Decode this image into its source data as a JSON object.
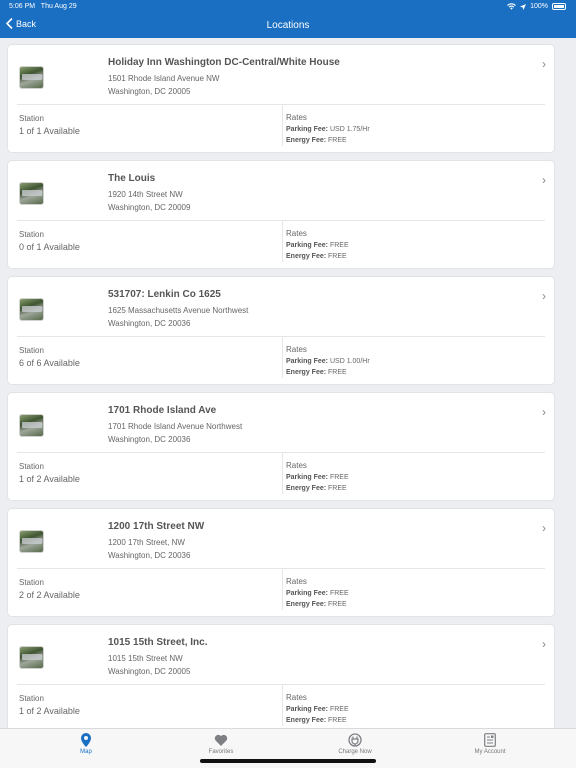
{
  "status": {
    "time": "5:06 PM",
    "date": "Thu Aug 29",
    "battery": "100%"
  },
  "nav": {
    "back_label": "Back",
    "title": "Locations"
  },
  "locations": [
    {
      "name": "Holiday Inn Washington DC-Central/White House",
      "address1": "1501 Rhode Island Avenue NW",
      "address2": "Washington, DC 20005",
      "station_label": "Station",
      "availability": "1 of 1 Available",
      "rates_label": "Rates",
      "parking_label": "Parking Fee:",
      "parking_fee": "USD 1.75/Hr",
      "energy_label": "Energy Fee:",
      "energy_fee": "FREE"
    },
    {
      "name": "The Louis",
      "address1": "1920 14th Street NW",
      "address2": "Washington, DC 20009",
      "station_label": "Station",
      "availability": "0 of 1 Available",
      "rates_label": "Rates",
      "parking_label": "Parking Fee:",
      "parking_fee": "FREE",
      "energy_label": "Energy Fee:",
      "energy_fee": "FREE"
    },
    {
      "name": "531707: Lenkin Co 1625",
      "address1": "1625 Massachusetts Avenue Northwest",
      "address2": "Washington, DC 20036",
      "station_label": "Station",
      "availability": "6 of 6 Available",
      "rates_label": "Rates",
      "parking_label": "Parking Fee:",
      "parking_fee": "USD 1.00/Hr",
      "energy_label": "Energy Fee:",
      "energy_fee": "FREE"
    },
    {
      "name": "1701 Rhode Island Ave",
      "address1": "1701 Rhode Island Avenue Northwest",
      "address2": "Washington, DC 20036",
      "station_label": "Station",
      "availability": "1 of 2 Available",
      "rates_label": "Rates",
      "parking_label": "Parking Fee:",
      "parking_fee": "FREE",
      "energy_label": "Energy Fee:",
      "energy_fee": "FREE"
    },
    {
      "name": "1200 17th Street NW",
      "address1": "1200 17th Street, NW",
      "address2": "Washington, DC 20036",
      "station_label": "Station",
      "availability": "2 of 2 Available",
      "rates_label": "Rates",
      "parking_label": "Parking Fee:",
      "parking_fee": "FREE",
      "energy_label": "Energy Fee:",
      "energy_fee": "FREE"
    },
    {
      "name": "1015 15th Street, Inc.",
      "address1": "1015 15th Street NW",
      "address2": "Washington, DC 20005",
      "station_label": "Station",
      "availability": "1 of 2 Available",
      "rates_label": "Rates",
      "parking_label": "Parking Fee:",
      "parking_fee": "FREE",
      "energy_label": "Energy Fee:",
      "energy_fee": "FREE"
    }
  ],
  "tabs": [
    {
      "label": "Map",
      "icon": "map-pin-icon",
      "active": true
    },
    {
      "label": "Favorites",
      "icon": "heart-icon",
      "active": false
    },
    {
      "label": "Charge Now",
      "icon": "charge-plug-icon",
      "active": false
    },
    {
      "label": "My Account",
      "icon": "account-card-icon",
      "active": false
    }
  ],
  "colors": {
    "accent": "#1a6fc2",
    "background": "#eceef2"
  }
}
